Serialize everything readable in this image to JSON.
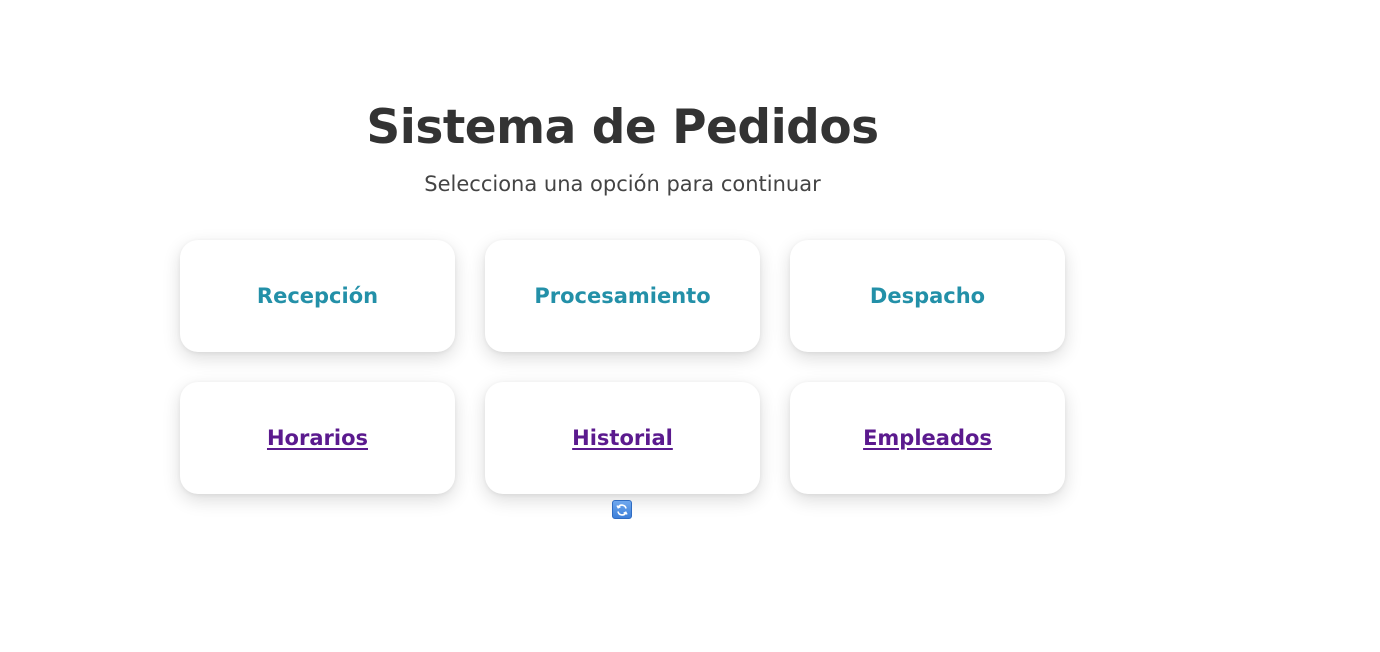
{
  "header": {
    "title": "Sistema de Pedidos",
    "subtitle": "Selecciona una opción para continuar"
  },
  "cards": [
    {
      "label": "Recepción",
      "style": "section"
    },
    {
      "label": "Procesamiento",
      "style": "section"
    },
    {
      "label": "Despacho",
      "style": "section"
    },
    {
      "label": "Horarios",
      "style": "link"
    },
    {
      "label": "Historial",
      "style": "link"
    },
    {
      "label": "Empleados",
      "style": "link"
    }
  ],
  "colors": {
    "section_text": "#2390a8",
    "link_text": "#5b1a8e",
    "title_text": "#333333"
  },
  "icons": {
    "refresh": "refresh-icon"
  }
}
